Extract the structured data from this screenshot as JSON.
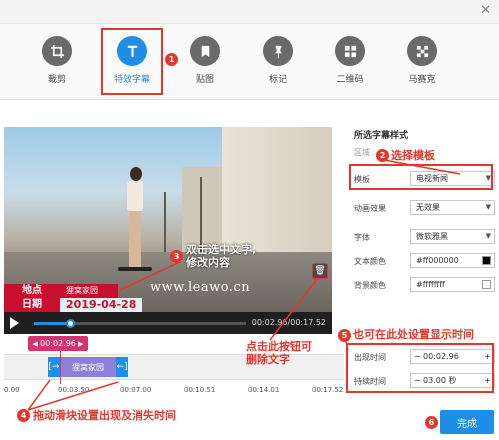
{
  "toolbar": {
    "items": [
      {
        "label": "裁剪",
        "icon": "crop-icon"
      },
      {
        "label": "特效字幕",
        "icon": "text-T-icon"
      },
      {
        "label": "贴图",
        "icon": "bookmark-icon"
      },
      {
        "label": "标记",
        "icon": "pin-icon"
      },
      {
        "label": "二维码",
        "icon": "grid-icon"
      },
      {
        "label": "马赛克",
        "icon": "mosaic-icon"
      }
    ],
    "active_index": 1
  },
  "annotations": {
    "a1": "1",
    "a2_num": "2",
    "a2": "选择模板",
    "a3_num": "3",
    "a3": "双击选中文字,\n修改内容",
    "a4_num": "4",
    "a4": "拖动滑块设置出现及消失时间",
    "a5_num": "5",
    "a5": "也可在此处设置显示时间",
    "a6_num": "6",
    "trash_note": "点击此按钮可\n删除文字"
  },
  "video": {
    "lower_third": {
      "row1_key": "地点",
      "row1_val": "狸窝家园",
      "row2_key": "日期",
      "row2_val": "2019-04-28",
      "url": "www.leawo.cn"
    }
  },
  "player": {
    "time": "00:02.96/00:17.52",
    "progress": 0.17
  },
  "timeline": {
    "current_time": "00:02.96",
    "clip_label": "狸窝家园",
    "ticks": [
      "0.00",
      "00:03.50",
      "00:07.00",
      "00:10.51",
      "00:14.01",
      "00:17.52"
    ]
  },
  "panel": {
    "title": "所选字幕样式",
    "info": "区域  ...1",
    "template_label": "模板",
    "template_value": "电视新闻",
    "animation_label": "动画效果",
    "animation_value": "无效果",
    "font_label": "字体",
    "font_value": "微软雅黑",
    "text_color_label": "文本颜色",
    "text_color_value": "#ff000000",
    "bg_color_label": "背景颜色",
    "bg_color_value": "#ffffffff",
    "appear_label": "出现时间",
    "appear_value": "00:02.96",
    "duration_label": "持续时间",
    "duration_value": "03.00 秒"
  },
  "done_label": "完成",
  "colors": {
    "accent": "#1e8ee6",
    "annotation": "#e6362b",
    "text_color_swatch": "#000000",
    "bg_color_swatch": "#ffffff"
  }
}
